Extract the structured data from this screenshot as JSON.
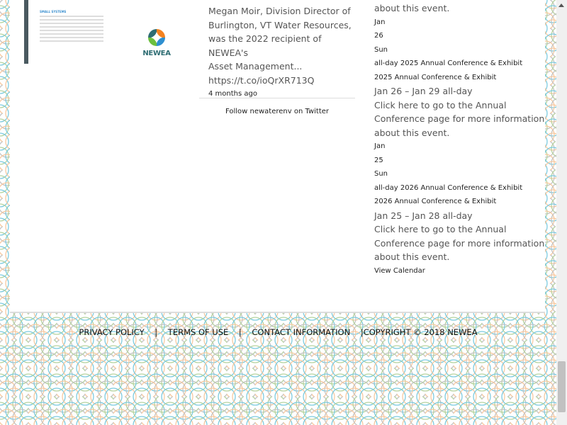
{
  "colors": {
    "pattern": [
      "#7ccbe0",
      "#f7c9a0",
      "#b7d3a0",
      "#c4c4c4"
    ],
    "accent": "#4a5a60"
  },
  "image": {
    "heading": "SMALL SYSTEMS",
    "logo_text": "NEWEA"
  },
  "tweet": {
    "lines": [
      "Megan Moir, Division Director of",
      "Burlington, VT Water Resources,",
      "was the 2022 recipient of NEWEA's",
      "Asset Management...",
      "https://t.co/ioQrXR713Q"
    ],
    "time": "4 months ago",
    "follow": "Follow newaterenv on Twitter"
  },
  "events": {
    "top_text": "about this event.",
    "items": [
      {
        "month": "Jan",
        "day": "26",
        "weekday": "Sun",
        "allday": "all-day 2025 Annual Conference & Exhibit",
        "title": "2025 Annual Conference & Exhibit",
        "dates": "Jan 26 – Jan 29 all-day",
        "desc": [
          "Click here to go to the Annual",
          "Conference page for more information",
          "about this event."
        ]
      },
      {
        "month": "Jan",
        "day": "25",
        "weekday": "Sun",
        "allday": "all-day 2026 Annual Conference & Exhibit",
        "title": "2026 Annual Conference & Exhibit",
        "dates": "Jan 25 – Jan 28 all-day",
        "desc": [
          "Click here to go to the Annual",
          "Conference page for more information",
          "about this event."
        ]
      }
    ],
    "view_calendar": "View Calendar"
  },
  "footer": {
    "privacy": "PRIVACY POLICY",
    "terms": "TERMS OF USE",
    "contact": "CONTACT INFORMATION",
    "sep": "|",
    "copyright": "COPYRIGHT © 2018 NEWEA"
  }
}
